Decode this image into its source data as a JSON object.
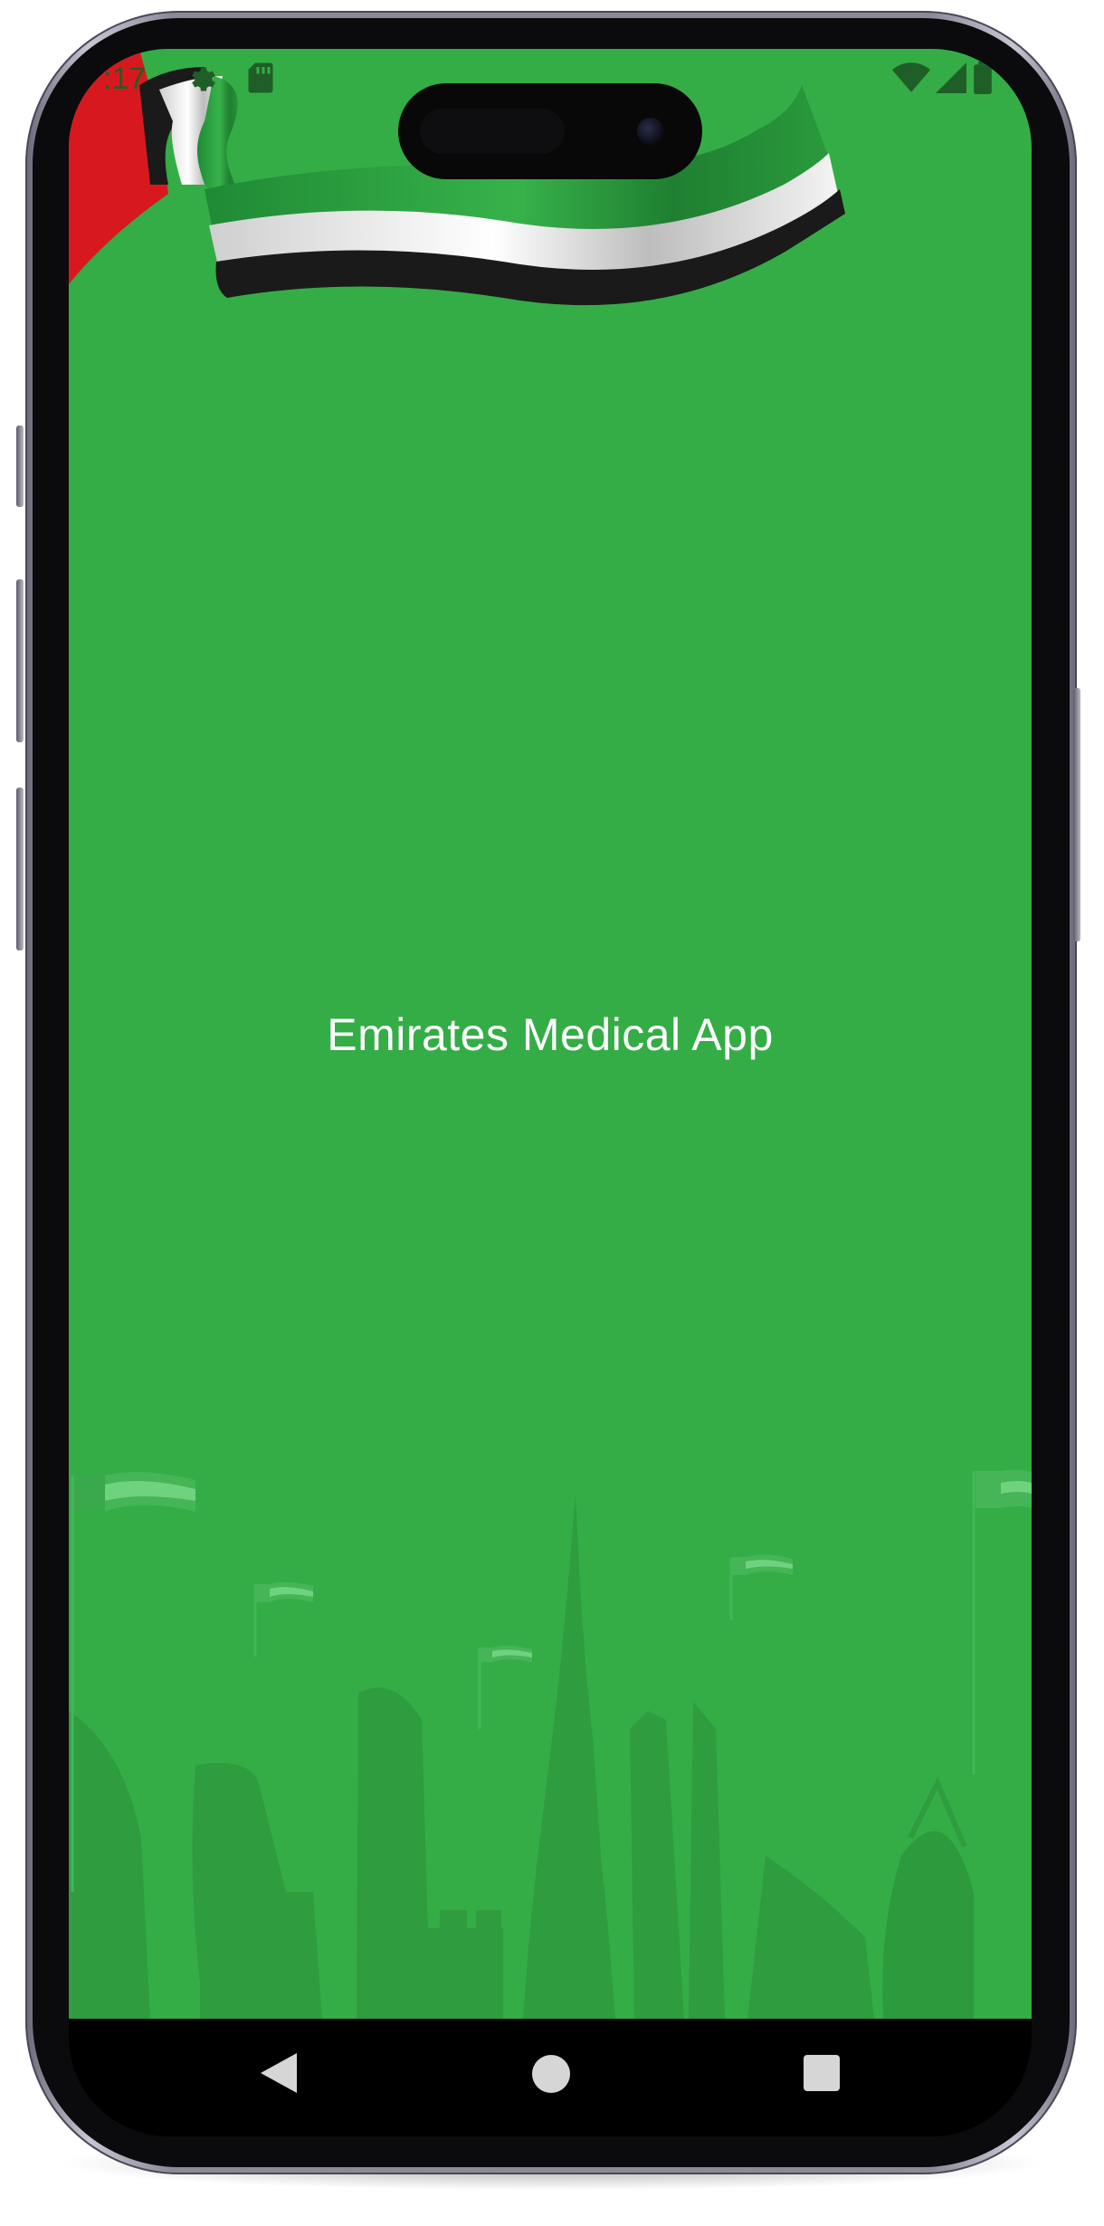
{
  "status_bar": {
    "time": ":17",
    "icons": [
      "gear-icon",
      "sd-card-icon",
      "wifi-icon",
      "signal-icon",
      "battery-icon"
    ]
  },
  "app": {
    "title": "Emirates Medical App"
  },
  "colors": {
    "screen_background": "#34ad46",
    "skyline": "#2f9c40",
    "flag_red": "#d7191f",
    "flag_green": "#2f9a3f",
    "flag_white": "#ffffff",
    "flag_black": "#1a1a1a",
    "nav_bar": "#000000"
  },
  "nav_bar": {
    "buttons": [
      "back-icon",
      "home-icon",
      "recents-icon"
    ]
  }
}
